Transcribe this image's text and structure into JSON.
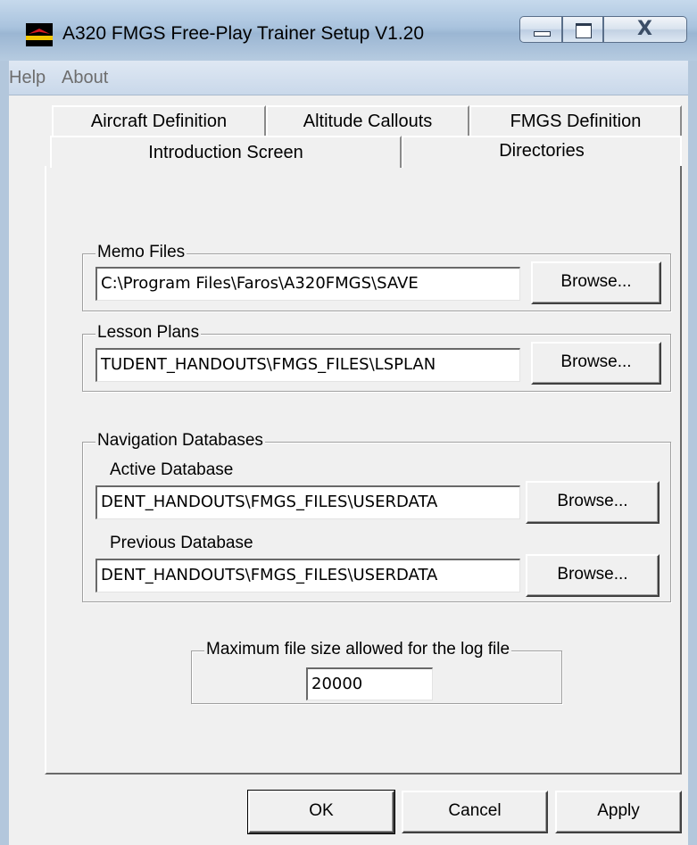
{
  "window": {
    "title": "A320 FMGS Free-Play Trainer Setup V1.20",
    "controls": {
      "minimize": "minimize-icon",
      "maximize": "maximize-icon",
      "close": "close-icon",
      "close_glyph": "X"
    }
  },
  "menu": [
    "Help",
    "About"
  ],
  "tabs": {
    "row1": [
      "Aircraft Definition",
      "Altitude Callouts",
      "FMGS Definition"
    ],
    "row2": [
      "Introduction Screen",
      "Directories"
    ],
    "active": "Directories"
  },
  "memo": {
    "label": "Memo Files",
    "value": "C:\\Program Files\\Faros\\A320FMGS\\SAVE",
    "browse": "Browse..."
  },
  "lesson": {
    "label": "Lesson Plans",
    "value": "TUDENT_HANDOUTS\\FMGS_FILES\\LSPLAN",
    "browse": "Browse..."
  },
  "nav": {
    "label": "Navigation Databases",
    "active_label": "Active Database",
    "active_value": "DENT_HANDOUTS\\FMGS_FILES\\USERDATA",
    "previous_label": "Previous Database",
    "previous_value": "DENT_HANDOUTS\\FMGS_FILES\\USERDATA",
    "browse": "Browse..."
  },
  "log": {
    "label": "Maximum file size allowed for the log file",
    "value": "20000"
  },
  "buttons": {
    "ok": "OK",
    "cancel": "Cancel",
    "apply": "Apply"
  }
}
